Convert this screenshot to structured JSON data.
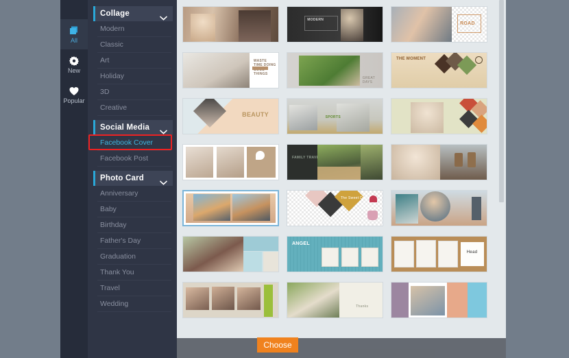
{
  "rail": {
    "items": [
      {
        "label": "All",
        "icon": "layers-icon",
        "active": true
      },
      {
        "label": "New",
        "icon": "burst-icon",
        "active": false
      },
      {
        "label": "Popular",
        "icon": "heart-icon",
        "active": false
      }
    ]
  },
  "sidebar": {
    "sections": [
      {
        "title": "Collage",
        "expand_icon": "chevron-down-icon",
        "items": [
          {
            "label": "Modern",
            "highlight": false
          },
          {
            "label": "Classic",
            "highlight": false
          },
          {
            "label": "Art",
            "highlight": false
          },
          {
            "label": "Holiday",
            "highlight": false
          },
          {
            "label": "3D",
            "highlight": false
          },
          {
            "label": "Creative",
            "highlight": false
          }
        ]
      },
      {
        "title": "Social Media",
        "expand_icon": "chevron-down-icon",
        "items": [
          {
            "label": "Facebook Cover",
            "highlight": true
          },
          {
            "label": "Facebook Post",
            "highlight": false
          }
        ]
      },
      {
        "title": "Photo Card",
        "expand_icon": "chevron-down-icon",
        "items": [
          {
            "label": "Anniversary",
            "highlight": false
          },
          {
            "label": "Baby",
            "highlight": false
          },
          {
            "label": "Birthday",
            "highlight": false
          },
          {
            "label": "Father's Day",
            "highlight": false
          },
          {
            "label": "Graduation",
            "highlight": false
          },
          {
            "label": "Thank You",
            "highlight": false
          },
          {
            "label": "Travel",
            "highlight": false
          },
          {
            "label": "Wedding",
            "highlight": false
          }
        ]
      }
    ]
  },
  "annotation": {
    "target": "Facebook Cover",
    "color": "#ee2222"
  },
  "templates": {
    "selected_index": 12,
    "rows": [
      [
        {
          "id": "t1",
          "caption": ""
        },
        {
          "id": "t2",
          "caption": "MODERN"
        },
        {
          "id": "t3",
          "caption": "ROAD"
        }
      ],
      [
        {
          "id": "t4",
          "caption": "WASTE TIME DOING GOOD THINGS"
        },
        {
          "id": "t5",
          "caption": "GREAT DAYS"
        },
        {
          "id": "t6",
          "caption": "THE MOMENT"
        }
      ],
      [
        {
          "id": "t7",
          "caption": "BEAUTY"
        },
        {
          "id": "t8",
          "caption": "SPORTS"
        },
        {
          "id": "t9",
          "caption": ""
        }
      ],
      [
        {
          "id": "t10",
          "caption": ""
        },
        {
          "id": "t11",
          "caption": "FAMILY TRAVEL"
        },
        {
          "id": "t12",
          "caption": ""
        }
      ],
      [
        {
          "id": "t13",
          "caption": "",
          "selected": true
        },
        {
          "id": "t14",
          "caption": "The Sweet Day"
        },
        {
          "id": "t15",
          "caption": ""
        }
      ],
      [
        {
          "id": "t16",
          "caption": ""
        },
        {
          "id": "t17",
          "caption": "ANGEL"
        },
        {
          "id": "t18",
          "caption": "Head"
        }
      ],
      [
        {
          "id": "t19",
          "caption": ""
        },
        {
          "id": "t20",
          "caption": "Thanks"
        },
        {
          "id": "t21",
          "caption": ""
        }
      ]
    ]
  },
  "footer": {
    "choose_label": "Choose",
    "choose_color": "#f0821e"
  },
  "colors": {
    "rail_bg": "#262c3a",
    "sidebar_bg": "#2f3545",
    "accent_cyan": "#2aa8d8",
    "grid_bg": "#e3e8eb",
    "page_bg": "#727d8a",
    "selection_border": "#7ab4d8"
  }
}
